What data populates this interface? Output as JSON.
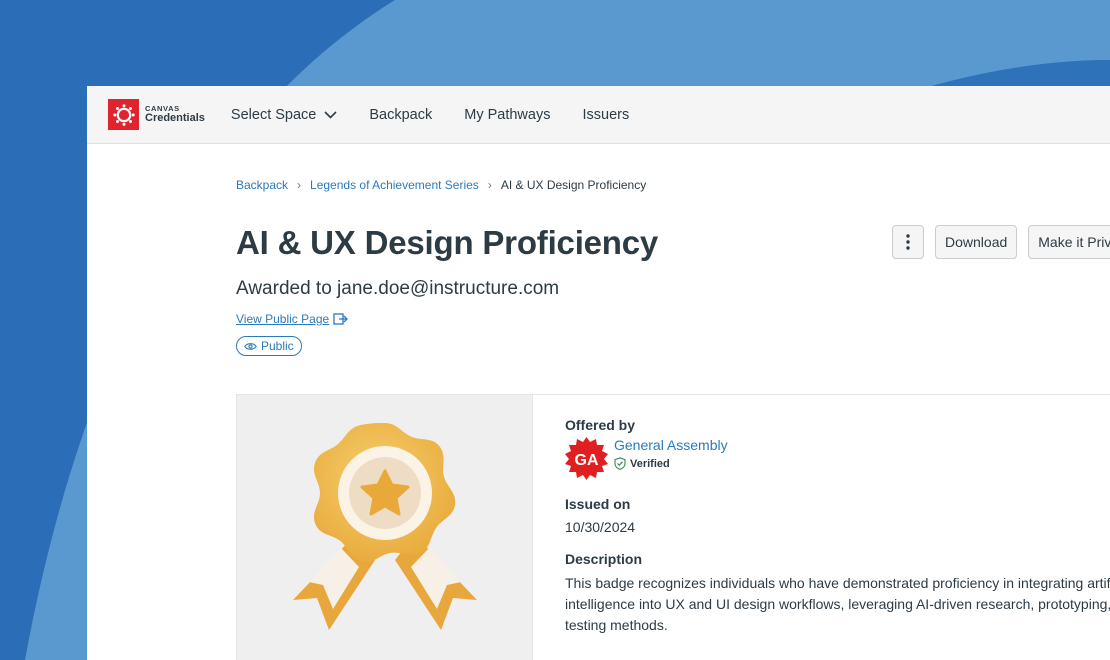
{
  "brand": {
    "line1": "CANVAS",
    "line2": "Credentials",
    "color": "#e0242e"
  },
  "nav": {
    "select_space": "Select Space",
    "backpack": "Backpack",
    "pathways": "My Pathways",
    "issuers": "Issuers"
  },
  "breadcrumb": {
    "items": [
      "Backpack",
      "Legends of Achievement Series"
    ],
    "current": "AI & UX Design Proficiency"
  },
  "badge": {
    "title": "AI & UX Design Proficiency",
    "awarded": "Awarded to jane.doe@instructure.com",
    "view_public": "View Public Page",
    "visibility": "Public"
  },
  "actions": {
    "download": "Download",
    "make_private": "Make it Private"
  },
  "details": {
    "offered_by_label": "Offered by",
    "issuer_name": "General Assembly",
    "issuer_logo_text": "GA",
    "verified": "Verified",
    "issued_on_label": "Issued on",
    "issued_on": "10/30/2024",
    "description_label": "Description",
    "description_lines": [
      "This badge recognizes individuals who have demonstrated proficiency in integrating artificial",
      "intelligence into UX and UI design workflows, leveraging AI-driven research, prototyping, and",
      "testing methods."
    ]
  },
  "colors": {
    "link": "#2b7abc",
    "text": "#2d3b45",
    "background": "#2b6cb8"
  }
}
